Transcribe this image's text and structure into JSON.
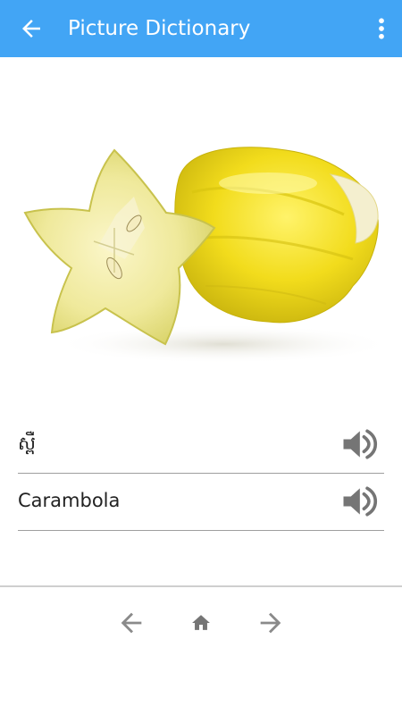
{
  "app_bar": {
    "title": "Picture Dictionary",
    "back_icon": "arrow-back-icon",
    "menu_icon": "more-vert-icon",
    "color": "#42a5f5"
  },
  "picture": {
    "subject_icon": "starfruit-image"
  },
  "entries": [
    {
      "word": "ស្ពឺ",
      "audio_icon": "speaker-icon"
    },
    {
      "word": "Carambola",
      "audio_icon": "speaker-icon"
    }
  ],
  "bottom_nav": {
    "previous_icon": "arrow-left-icon",
    "home_icon": "home-icon",
    "next_icon": "arrow-right-icon"
  }
}
